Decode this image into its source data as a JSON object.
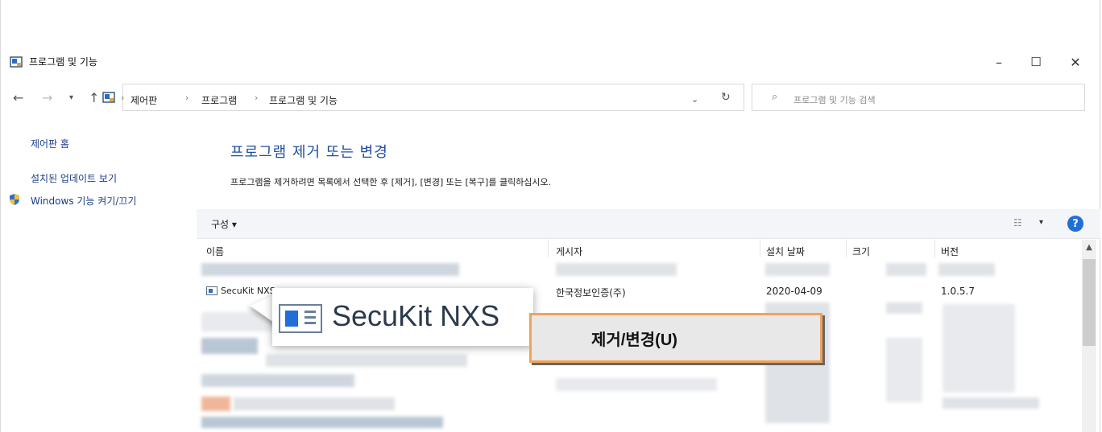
{
  "window": {
    "title": "프로그램 및 기능",
    "minimize": "–",
    "maximize": "☐",
    "close": "✕"
  },
  "address": {
    "crumbs": [
      "제어판",
      "프로그램",
      "프로그램 및 기능"
    ],
    "separator": "›",
    "search_placeholder": "프로그램 및 기능 검색"
  },
  "sidebar": {
    "items": [
      {
        "label": "제어판 홈"
      },
      {
        "label": "설치된 업데이트 보기"
      },
      {
        "label": "Windows 기능 켜기/끄기"
      }
    ]
  },
  "main": {
    "heading": "프로그램 제거 또는 변경",
    "subheading": "프로그램을 제거하려면 목록에서 선택한 후 [제거], [변경] 또는 [복구]를 클릭하십시오.",
    "toolbar": {
      "organize": "구성 ▾",
      "help": "?"
    },
    "columns": [
      "이름",
      "게시자",
      "설치 날짜",
      "크기",
      "버전"
    ],
    "selected_row": {
      "name": "SecuKit NXS",
      "publisher": "한국정보인증(주)",
      "install_date": "2020-04-09",
      "size": "",
      "version": "1.0.5.7"
    }
  },
  "callout": {
    "label": "SecuKit NXS"
  },
  "context_button": {
    "label": "제거/변경(U)"
  },
  "colors": {
    "heading_blue": "#1e4fa0",
    "highlight_orange": "#f0a35a",
    "help_blue": "#1f6fd6"
  }
}
